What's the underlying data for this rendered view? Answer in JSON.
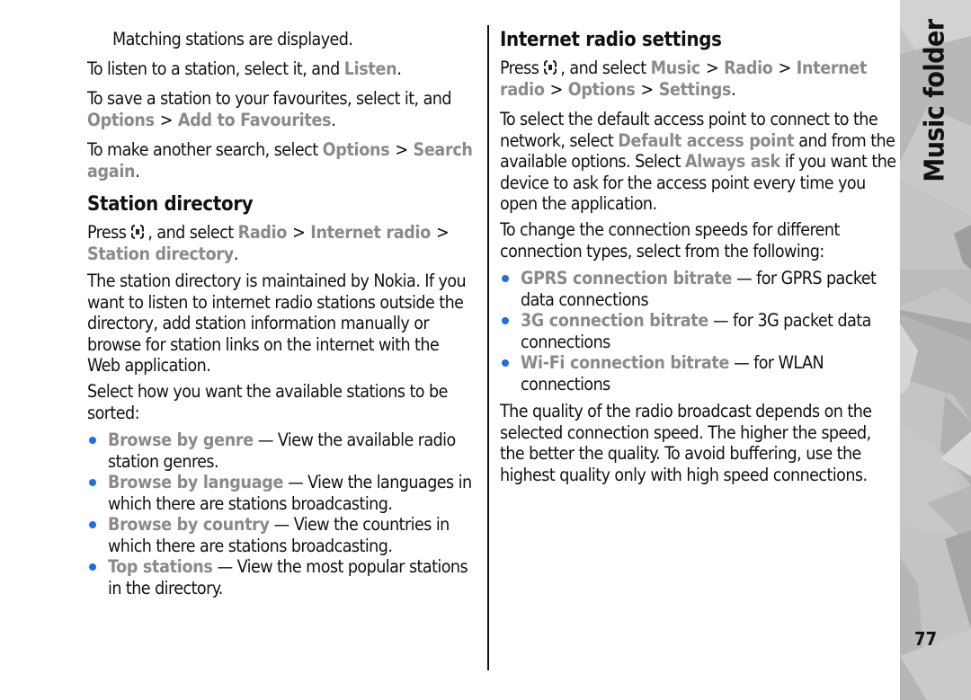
{
  "page": {
    "section_tab": "Music folder",
    "page_number": "77",
    "colors": {
      "highlight_text": "#8a8a8a",
      "bullet": "#1f6fe0",
      "body_text": "#111111",
      "side_tab": "#c4c4c4"
    }
  },
  "left": {
    "p1": "Matching stations are displayed.",
    "p2": {
      "pre": "To listen to a station, select it, and ",
      "hl": "Listen",
      "post": "."
    },
    "p3": {
      "line1": "To save a station to your favourites, select it, and",
      "hl1": "Options",
      "sep": ">",
      "hl2": "Add to Favourites",
      "post": "."
    },
    "p4": {
      "pre": "To make another search, select ",
      "hl1": "Options",
      "sep": ">",
      "hl2a": "Search",
      "hl2b": "again",
      "post": "."
    },
    "station_directory": {
      "heading": "Station directory",
      "press": "Press",
      "key_icon": "menu-key-icon",
      "and_select": ", and select ",
      "path": [
        "Radio",
        "Internet radio",
        "Station directory"
      ],
      "sep": ">",
      "post": ".",
      "desc_lines": [
        "The station directory is maintained by Nokia. If you",
        "want to listen to internet radio stations outside the",
        "directory, add station information manually or",
        "browse for station links on the internet with the",
        "Web application."
      ],
      "sort_lines": [
        "Select how you want the available stations to be",
        "sorted:"
      ],
      "options": [
        {
          "label": "Browse by genre",
          "desc1": " — View the available radio",
          "desc2": "station genres."
        },
        {
          "label": "Browse by language",
          "desc1": " — View the languages in",
          "desc2": "which there are stations broadcasting."
        },
        {
          "label": "Browse by country",
          "desc1": " — View the countries in",
          "desc2": "which there are stations broadcasting."
        },
        {
          "label": "Top stations",
          "desc1": " — View the most popular stations",
          "desc2": "in the directory."
        }
      ]
    }
  },
  "right": {
    "heading": "Internet radio settings",
    "press": "Press",
    "and_select": ", and select ",
    "path": [
      "Music",
      "Radio",
      "Internet",
      "radio",
      "Options",
      "Settings"
    ],
    "sep": ">",
    "post": ".",
    "access_point": {
      "line1": "To select the default access point to connect to the",
      "line2_pre": "network, select ",
      "line2_hl": "Default access point",
      "line2_post": " and from the",
      "line3_pre": "available options. Select ",
      "line3_hl": "Always ask",
      "line3_post": " if you want the",
      "line4": "device to ask for the access point every time you",
      "line5": "open the application."
    },
    "speed_intro": [
      "To change the connection speeds for different",
      "connection types, select from the following:"
    ],
    "bitrates": [
      {
        "label": "GPRS connection bitrate",
        "desc1": " — for GPRS packet",
        "desc2": "data connections"
      },
      {
        "label": "3G connection bitrate",
        "desc1": " — for 3G packet data",
        "desc2": "connections"
      },
      {
        "label": "Wi-Fi connection bitrate",
        "desc1": " — for WLAN",
        "desc2": "connections"
      }
    ],
    "quality_lines": [
      "The quality of the radio broadcast depends on the",
      "selected connection speed. The higher the speed,",
      "the better the quality. To avoid buffering, use the",
      "highest quality only with high speed connections."
    ]
  }
}
